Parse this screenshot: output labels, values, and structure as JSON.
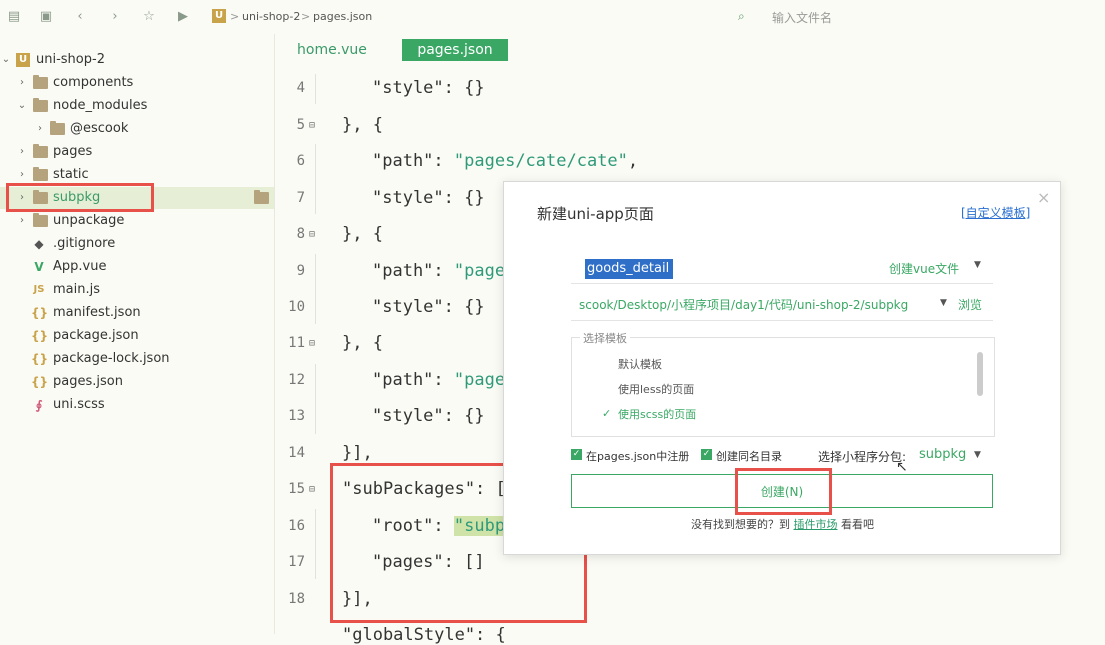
{
  "toolbar": {
    "breadcrumb": [
      "uni-shop-2",
      "pages.json"
    ],
    "breadcrumb_sep": ">",
    "logo_letter": "U",
    "file_search_placeholder": "输入文件名"
  },
  "sidebar": {
    "project": "uni-shop-2",
    "items": [
      {
        "label": "components"
      },
      {
        "label": "node_modules"
      },
      {
        "label": "@escook"
      },
      {
        "label": "pages"
      },
      {
        "label": "static"
      },
      {
        "label": "subpkg"
      },
      {
        "label": "unpackage"
      },
      {
        "label": ".gitignore"
      },
      {
        "label": "App.vue"
      },
      {
        "label": "main.js"
      },
      {
        "label": "manifest.json"
      },
      {
        "label": "package.json"
      },
      {
        "label": "package-lock.json"
      },
      {
        "label": "pages.json"
      },
      {
        "label": "uni.scss"
      }
    ]
  },
  "editor": {
    "tabs": [
      "home.vue",
      "pages.json"
    ],
    "line_numbers": [
      "4",
      "5",
      "6",
      "7",
      "8",
      "9",
      "10",
      "11",
      "12",
      "13",
      "14",
      "15",
      "16",
      "17",
      "18"
    ],
    "lines": {
      "l4_key": "\"style\"",
      "l4_rest": ": {}",
      "l5": "}, {",
      "l6_key": "\"path\"",
      "l6_sep": ": ",
      "l6_val": "\"pages/cate/cate\"",
      "l6_end": ",",
      "l7_key": "\"style\"",
      "l7_rest": ": {}",
      "l8": "}, {",
      "l9_key": "\"path\"",
      "l9_sep": ": ",
      "l9_val": "\"page",
      "l10_key": "\"style\"",
      "l10_rest": ": {}",
      "l11": "}, {",
      "l12_key": "\"path\"",
      "l12_sep": ": ",
      "l12_val": "\"page",
      "l13_key": "\"style\"",
      "l13_rest": ": {}",
      "l14": "}],",
      "l15": "\"subPackages\": [",
      "l16_key": "\"root\"",
      "l16_sep": ": ",
      "l16_val": "\"subp",
      "l17_key": "\"pages\"",
      "l17_rest": ": []",
      "l18": "}],",
      "l19": "\"globalStyle\": {"
    }
  },
  "dialog": {
    "title": "新建uni-app页面",
    "custom_template_link": "[自定义模板]",
    "close_glyph": "×",
    "page_name_value": "goods_detail",
    "create_vue_option": "创建vue文件",
    "path_value": "scook/Desktop/小程序项目/day1/代码/uni-shop-2/subpkg",
    "browse_label": "浏览",
    "template_legend": "选择模板",
    "template_options": [
      "默认模板",
      "使用less的页面",
      "使用scss的页面"
    ],
    "selected_template_index": 2,
    "check_register": "在pages.json中注册",
    "check_same_dir": "创建同名目录",
    "subpackage_label": "选择小程序分包:",
    "subpackage_value": "subpkg",
    "create_button": "创建(N)",
    "footer_text": "没有找到想要的？到 ",
    "footer_link": "插件市场",
    "footer_end": " 看看吧"
  },
  "colors": {
    "accent": "#3aa864",
    "annotation_red": "#e8504a",
    "string": "#2f9a7a",
    "selection_blue": "#2f6fc8"
  }
}
